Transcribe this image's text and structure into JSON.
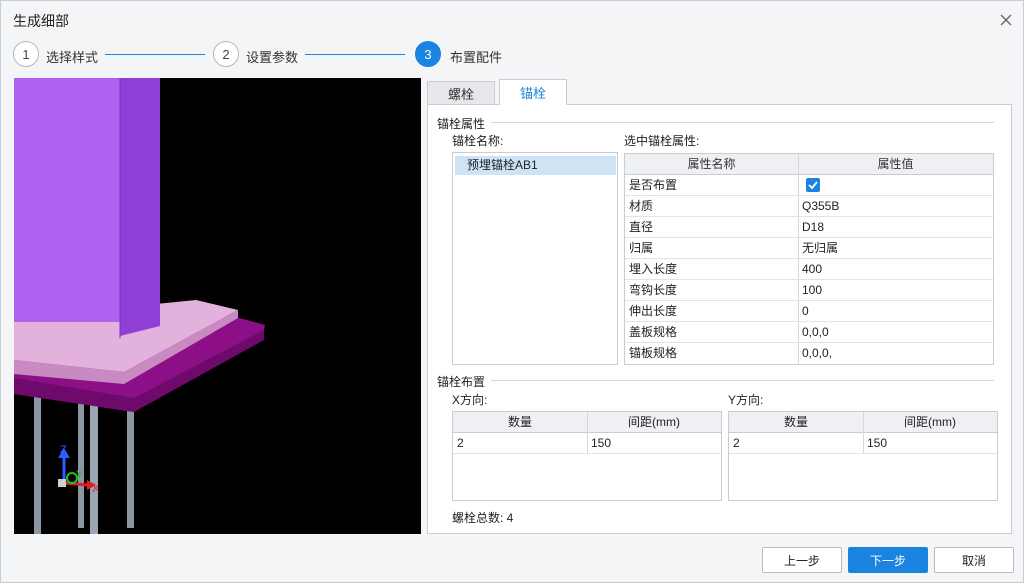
{
  "window": {
    "title": "生成细部"
  },
  "steps": [
    {
      "num": "1",
      "label": "选择样式"
    },
    {
      "num": "2",
      "label": "设置参数"
    },
    {
      "num": "3",
      "label": "布置配件"
    }
  ],
  "tabs": [
    {
      "label": "螺栓"
    },
    {
      "label": "锚栓"
    }
  ],
  "anchor_props": {
    "title": "锚栓属性",
    "name_label": "锚栓名称:",
    "selected_label": "选中锚栓属性:",
    "list": [
      "预埋锚栓AB1"
    ],
    "headers": [
      "属性名称",
      "属性值"
    ],
    "rows": [
      {
        "name": "是否布置",
        "value": "",
        "checked": true
      },
      {
        "name": "材质",
        "value": "Q355B"
      },
      {
        "name": "直径",
        "value": "D18"
      },
      {
        "name": "归属",
        "value": "无归属"
      },
      {
        "name": "埋入长度",
        "value": "400"
      },
      {
        "name": "弯钩长度",
        "value": "100"
      },
      {
        "name": "伸出长度",
        "value": "0"
      },
      {
        "name": "盖板规格",
        "value": "0,0,0"
      },
      {
        "name": "锚板规格",
        "value": "0,0,0,"
      }
    ]
  },
  "layout_group": {
    "title": "锚栓布置",
    "x_label": "X方向:",
    "y_label": "Y方向:",
    "headers": [
      "数量",
      "间距(mm)"
    ],
    "x_rows": [
      {
        "count": "2",
        "spacing": "150"
      }
    ],
    "y_rows": [
      {
        "count": "2",
        "spacing": "150"
      }
    ]
  },
  "total": "螺栓总数: 4",
  "viewport": {
    "axis_x": "X",
    "axis_y": "Y",
    "axis_z": "Z"
  },
  "buttons": {
    "prev": "上一步",
    "next": "下一步",
    "cancel": "取消"
  },
  "colors": {
    "accent": "#1a84e0",
    "column": "#b061f0",
    "plate_top": "#e2b1dc",
    "plate_base": "#8c0f88"
  }
}
